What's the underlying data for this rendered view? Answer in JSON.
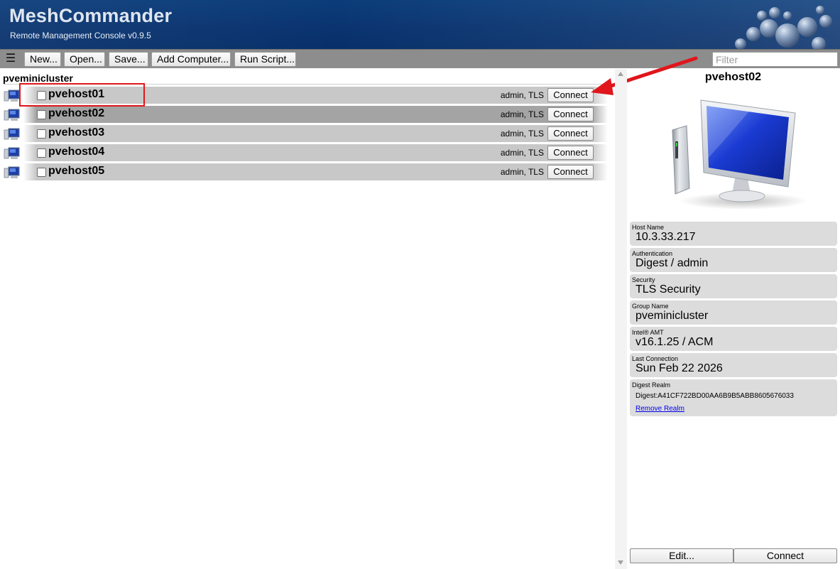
{
  "header": {
    "title": "MeshCommander",
    "subtitle": "Remote Management Console v0.9.5"
  },
  "toolbar": {
    "menu_icon": "hamburger-menu-icon",
    "buttons": [
      "New...",
      "Open...",
      "Save...",
      "Add Computer...",
      "Run Script..."
    ],
    "filter_placeholder": "Filter",
    "filter_value": ""
  },
  "group": {
    "name": "pveminicluster",
    "hosts": [
      {
        "name": "pvehost01",
        "auth": "admin, TLS",
        "action": "Connect",
        "checked": false
      },
      {
        "name": "pvehost02",
        "auth": "admin, TLS",
        "action": "Connect",
        "checked": false,
        "selected": true
      },
      {
        "name": "pvehost03",
        "auth": "admin, TLS",
        "action": "Connect",
        "checked": false
      },
      {
        "name": "pvehost04",
        "auth": "admin, TLS",
        "action": "Connect",
        "checked": false
      },
      {
        "name": "pvehost05",
        "auth": "admin, TLS",
        "action": "Connect",
        "checked": false
      }
    ]
  },
  "details": {
    "title": "pvehost02",
    "fields": [
      {
        "label": "Host Name",
        "value": "10.3.33.217"
      },
      {
        "label": "Authentication",
        "value": "Digest / admin"
      },
      {
        "label": "Security",
        "value": "TLS Security"
      },
      {
        "label": "Group Name",
        "value": "pveminicluster"
      },
      {
        "label": "Intel® AMT",
        "value": "v16.1.25 / ACM"
      },
      {
        "label": "Last Connection",
        "value": "Sun Feb 22 2026"
      }
    ],
    "realm": {
      "label": "Digest Realm",
      "value": "Digest:A41CF722BD00AA6B9B5ABB8605676033",
      "link": "Remove Realm"
    },
    "edit_label": "Edit...",
    "connect_label": "Connect"
  },
  "colors": {
    "header_bg": "#0a3470",
    "toolbar_bg": "#8d8d8d",
    "row_bg": "#c8c8c8",
    "row_selected_bg": "#a4a4a4",
    "annotation_red": "#e0161b"
  }
}
